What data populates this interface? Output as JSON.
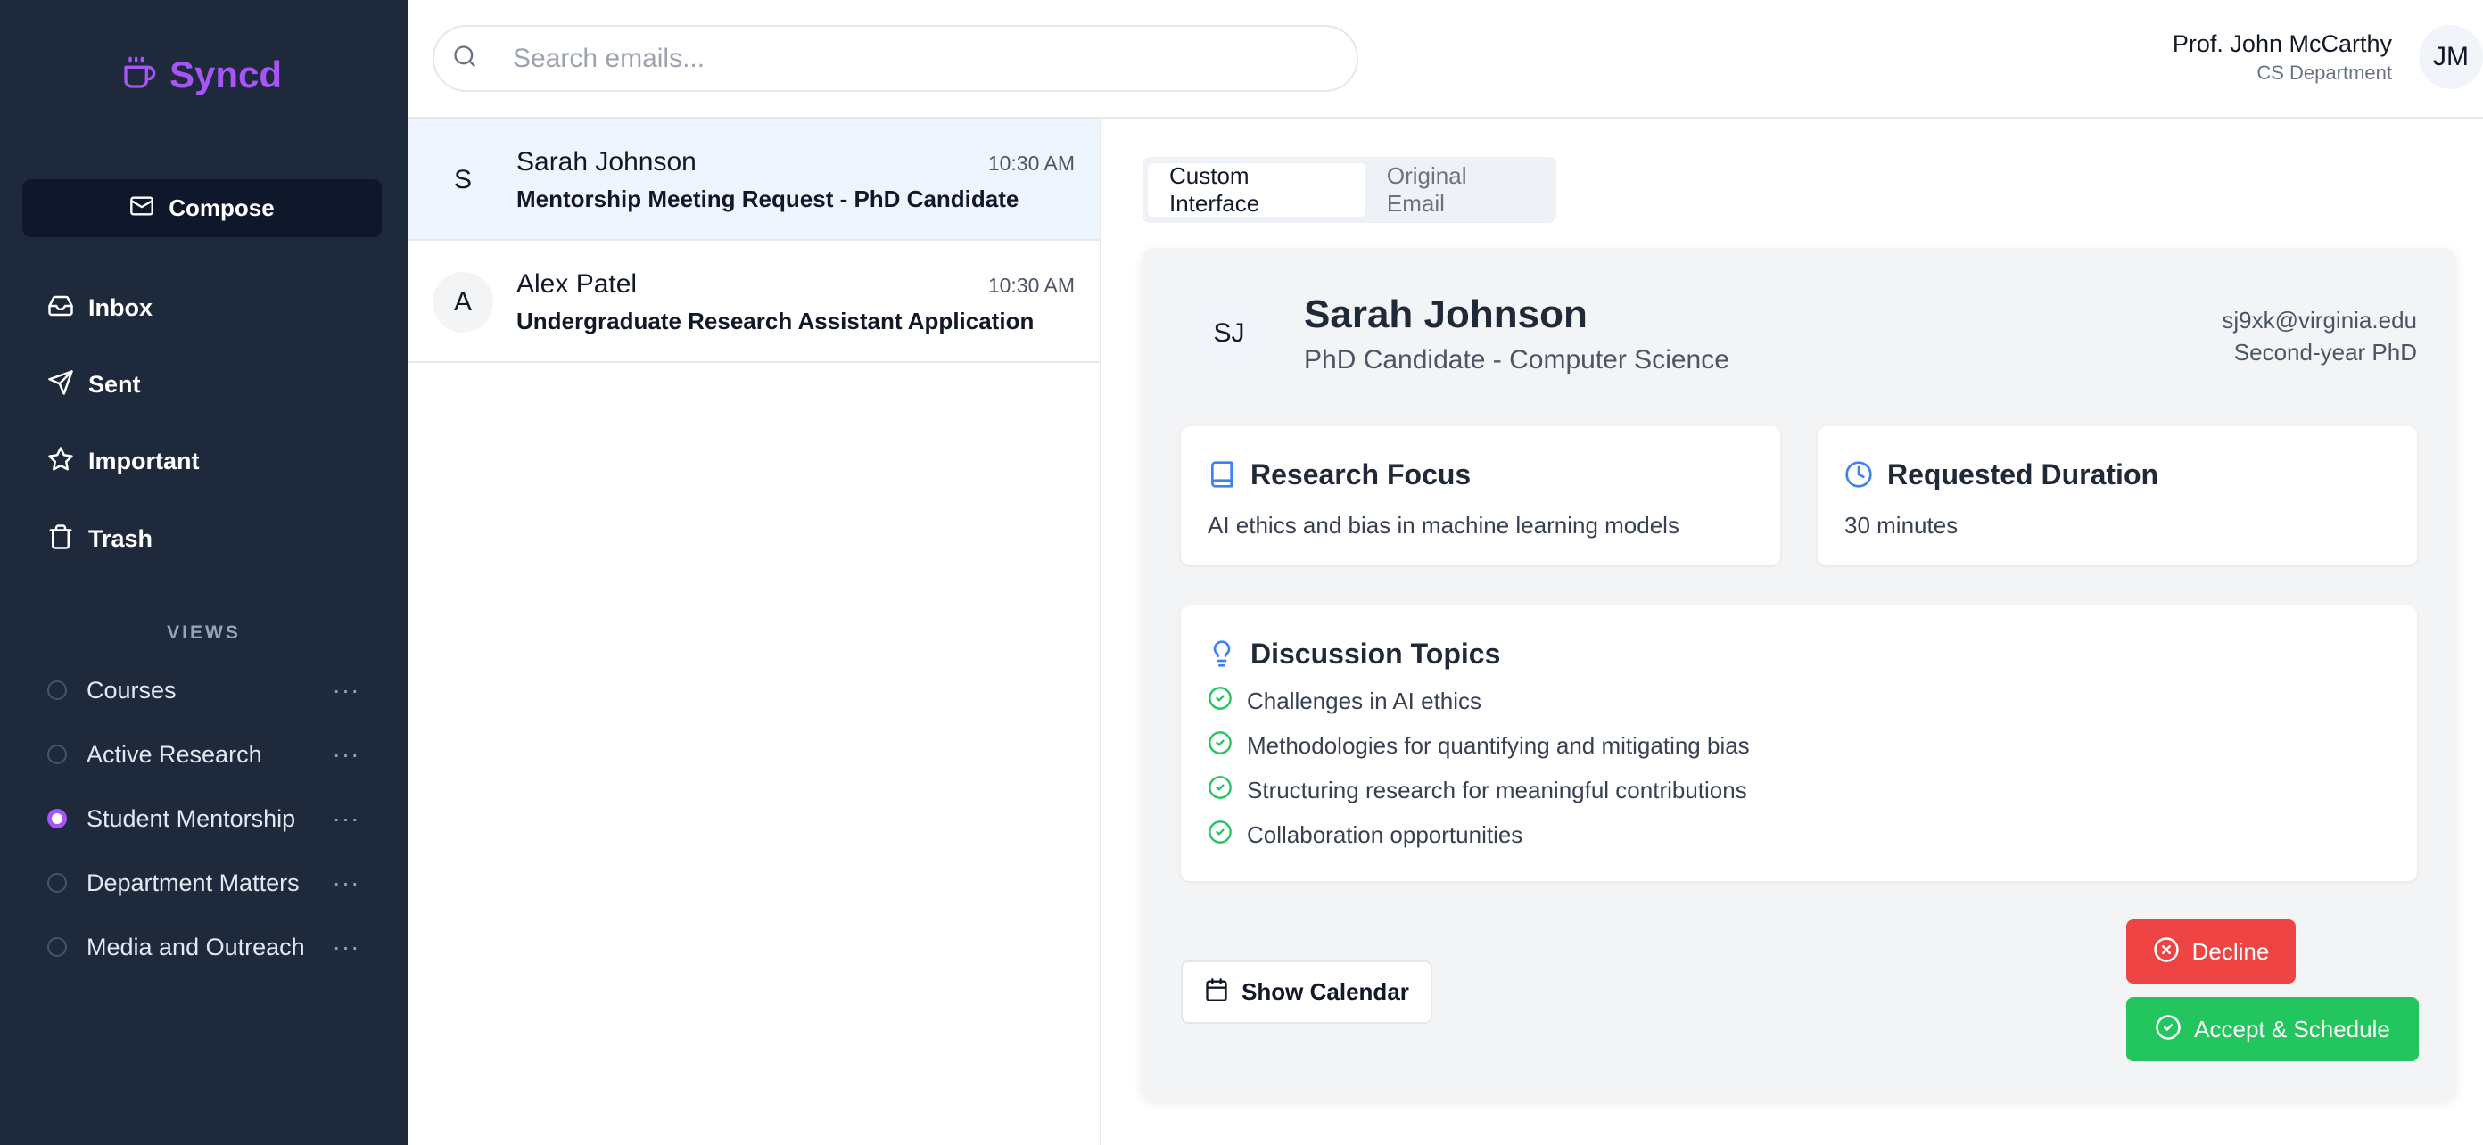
{
  "app": {
    "name": "Syncd",
    "accent": "#a855f7"
  },
  "sidebar": {
    "compose_label": "Compose",
    "nav": [
      {
        "label": "Inbox",
        "icon": "inbox-icon"
      },
      {
        "label": "Sent",
        "icon": "send-icon"
      },
      {
        "label": "Important",
        "icon": "star-icon"
      },
      {
        "label": "Trash",
        "icon": "trash-icon"
      }
    ],
    "views_header": "VIEWS",
    "views": [
      {
        "label": "Courses",
        "selected": false
      },
      {
        "label": "Active Research",
        "selected": false
      },
      {
        "label": "Student Mentorship",
        "selected": true
      },
      {
        "label": "Department Matters",
        "selected": false
      },
      {
        "label": "Media and Outreach",
        "selected": false
      }
    ],
    "more_glyph": "···"
  },
  "header": {
    "search_placeholder": "Search emails...",
    "user_name": "Prof. John McCarthy",
    "user_dept": "CS Department",
    "user_initials": "JM"
  },
  "emails": [
    {
      "initial": "S",
      "from": "Sarah Johnson",
      "time": "10:30 AM",
      "subject": "Mentorship Meeting Request - PhD Candidate",
      "selected": true
    },
    {
      "initial": "A",
      "from": "Alex Patel",
      "time": "10:30 AM",
      "subject": "Undergraduate Research Assistant Application",
      "selected": false
    }
  ],
  "detail": {
    "tabs": [
      {
        "label": "Custom Interface",
        "active": true
      },
      {
        "label": "Original Email",
        "active": false
      }
    ],
    "sender": {
      "initials": "SJ",
      "name": "Sarah Johnson",
      "role": "PhD Candidate - Computer Science",
      "email": "sj9xk@virginia.edu",
      "year": "Second-year PhD"
    },
    "research_focus": {
      "title": "Research Focus",
      "body": "AI ethics and bias in machine learning models"
    },
    "duration": {
      "title": "Requested Duration",
      "body": "30 minutes"
    },
    "topics": {
      "title": "Discussion Topics",
      "items": [
        "Challenges in AI ethics",
        "Methodologies for quantifying and mitigating bias",
        "Structuring research for meaningful contributions",
        "Collaboration opportunities"
      ]
    },
    "actions": {
      "calendar": "Show Calendar",
      "decline": "Decline",
      "accept": "Accept & Schedule"
    },
    "colors": {
      "decline": "#ef4444",
      "accept": "#22c55e",
      "icon_blue": "#3b82f6",
      "check_green": "#22c55e"
    }
  }
}
